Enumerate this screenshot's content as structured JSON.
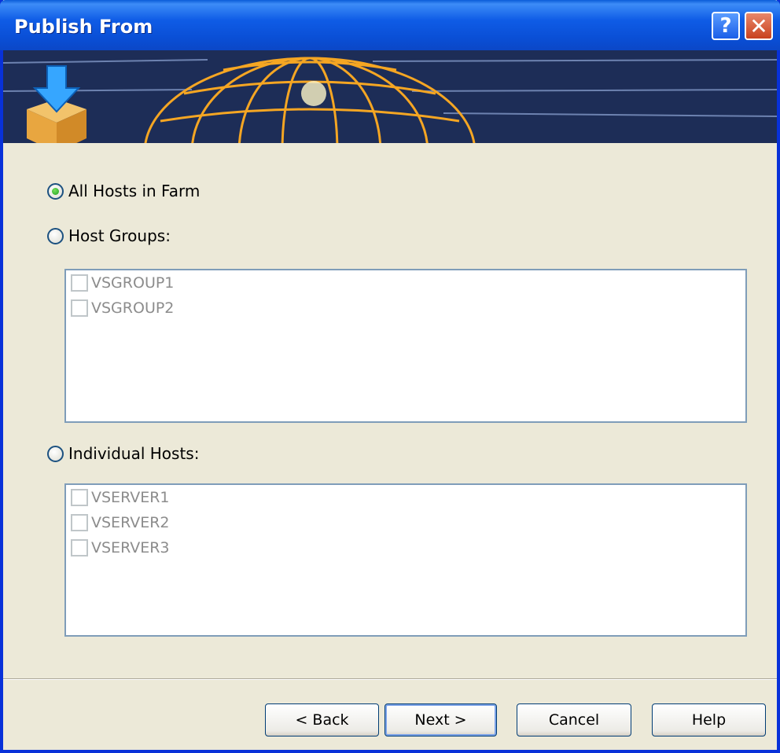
{
  "window": {
    "title": "Publish From",
    "help_label": "?",
    "close_label": "✕"
  },
  "banner": {
    "icon": "download-box-icon",
    "graphic": "globe-icon"
  },
  "options": {
    "all_hosts": {
      "label": "All Hosts in Farm",
      "selected": true
    },
    "host_groups": {
      "label": "Host Groups:",
      "selected": false,
      "items": [
        "VSGROUP1",
        "VSGROUP2"
      ]
    },
    "individual_hosts": {
      "label": "Individual Hosts:",
      "selected": false,
      "items": [
        "VSERVER1",
        "VSERVER2",
        "VSERVER3"
      ]
    }
  },
  "buttons": {
    "back": "< Back",
    "next": "Next >",
    "cancel": "Cancel",
    "help": "Help"
  },
  "colors": {
    "title_bar": "#0a4fd6",
    "dialog_bg": "#ece9d8",
    "banner_bg": "#1d2d57",
    "globe": "#f5a623",
    "radio_selected": "#21a121"
  }
}
